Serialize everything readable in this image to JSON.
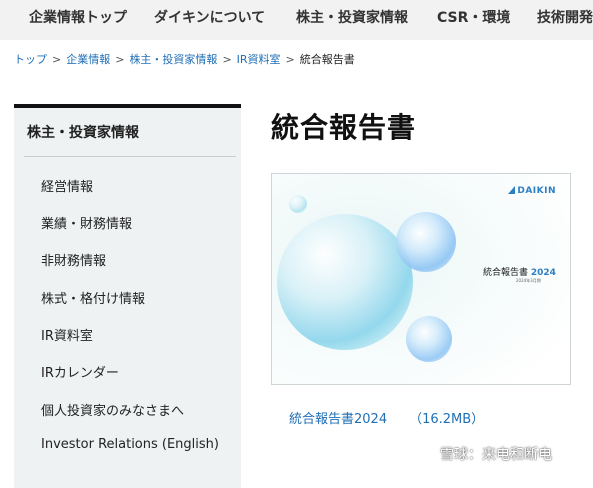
{
  "top_nav": {
    "items": [
      "企業情報トップ",
      "ダイキンについて",
      "株主・投資家情報",
      "CSR・環境",
      "技術開発"
    ]
  },
  "breadcrumb": {
    "items": [
      "トップ",
      "企業情報",
      "株主・投資家情報",
      "IR資料室"
    ],
    "current": "統合報告書",
    "separator": ">"
  },
  "sidebar": {
    "title": "株主・投資家情報",
    "items": [
      "経営情報",
      "業績・財務情報",
      "非財務情報",
      "株式・格付け情報",
      "IR資料室",
      "IRカレンダー",
      "個人投資家のみなさまへ",
      "Investor Relations (English)"
    ]
  },
  "main": {
    "title": "統合報告書",
    "cover": {
      "logo": "DAIKIN",
      "title": "統合報告書",
      "year": "2024",
      "subtitle": "2024年3月期"
    },
    "report_link": {
      "label": "統合報告書2024",
      "size": "（16.2MB）"
    }
  },
  "watermark": "雪球：来电和断电",
  "colors": {
    "link": "#1f6fb5",
    "nav_bg": "#f2f2f2",
    "sidebar_bg": "#eef2f2",
    "brand": "#2b7fc5"
  }
}
